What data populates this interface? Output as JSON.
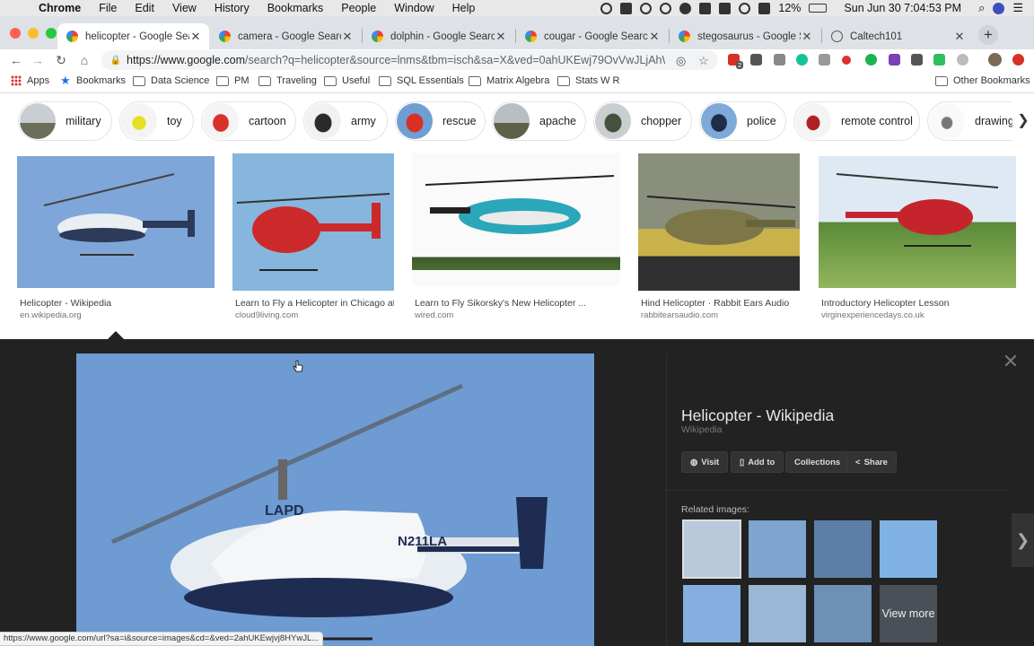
{
  "menubar": {
    "app": "Chrome",
    "items": [
      "File",
      "Edit",
      "View",
      "History",
      "Bookmarks",
      "People",
      "Window",
      "Help"
    ],
    "battery": "12%",
    "clock": "Sun Jun 30  7:04:53 PM"
  },
  "tabs": [
    {
      "label": "helicopter - Google Search",
      "active": true,
      "icon": "google-icon"
    },
    {
      "label": "camera - Google Search",
      "active": false,
      "icon": "google-icon"
    },
    {
      "label": "dolphin - Google Search",
      "active": false,
      "icon": "google-icon"
    },
    {
      "label": "cougar - Google Search",
      "active": false,
      "icon": "google-icon"
    },
    {
      "label": "stegosaurus - Google Search",
      "active": false,
      "icon": "google-icon"
    },
    {
      "label": "Caltech101",
      "active": false,
      "icon": "globe-icon"
    }
  ],
  "toolbar": {
    "url_host": "https://www.google.com",
    "url_rest": "/search?q=helicopter&source=lnms&tbm=isch&sa=X&ved=0ahUKEwj79OvVwJLjAhWG...",
    "extension_badge": "2"
  },
  "bookmarks": {
    "items": [
      "Apps",
      "Bookmarks",
      "Data Science",
      "PM",
      "Traveling",
      "Useful",
      "SQL Essentials",
      "Matrix Algebra",
      "Stats W R"
    ],
    "other": "Other Bookmarks"
  },
  "chips": [
    "military",
    "toy",
    "cartoon",
    "army",
    "rescue",
    "apache",
    "chopper",
    "police",
    "remote control",
    "drawing"
  ],
  "results": [
    {
      "caption": "Helicopter - Wikipedia",
      "source": "en.wikipedia.org"
    },
    {
      "caption": "Learn to Fly a Helicopter in Chicago at...",
      "source": "cloud9living.com"
    },
    {
      "caption": "Learn to Fly Sikorsky's New Helicopter ...",
      "source": "wired.com"
    },
    {
      "caption": "Hind Helicopter · Rabbit Ears Audio",
      "source": "rabbitearsaudio.com"
    },
    {
      "caption": "Introductory Helicopter Lesson",
      "source": "virginexperiencedays.co.uk"
    }
  ],
  "preview": {
    "title": "Helicopter - Wikipedia",
    "subtitle": "Wikipedia",
    "buttons": {
      "visit": "Visit",
      "add_to": "Add to",
      "collections": "Collections",
      "share": "Share"
    },
    "related_label": "Related images:",
    "view_more": "View more",
    "tail_number": "N211LA",
    "lapd": "LAPD"
  },
  "status_url": "https://www.google.com/url?sa=i&source=images&cd=&ved=2ahUKEwjvj8HYwJL..."
}
